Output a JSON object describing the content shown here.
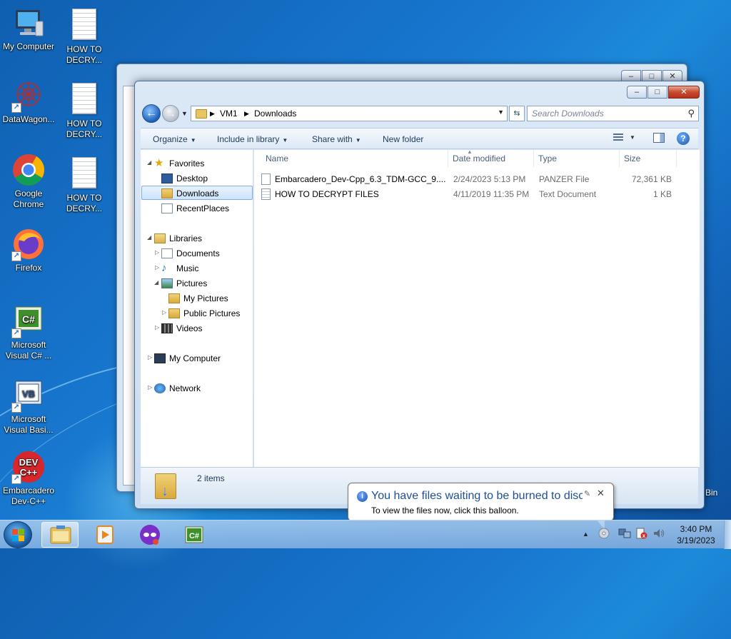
{
  "desktop": {
    "icons": [
      {
        "label": "My Computer"
      },
      {
        "label": "HOW TO DECRY..."
      },
      {
        "label": "DataWagon..."
      },
      {
        "label": "HOW TO DECRY..."
      },
      {
        "label": "Google Chrome"
      },
      {
        "label": "HOW TO DECRY..."
      },
      {
        "label": "Firefox"
      },
      {
        "label": "Microsoft Visual C# ..."
      },
      {
        "label": "Microsoft Visual Basi..."
      },
      {
        "label": "Embarcadero Dev-C++"
      }
    ],
    "bin_label": "Bin"
  },
  "explorer": {
    "caption": {
      "minimize": "–",
      "maximize": "□",
      "close": "✕"
    },
    "breadcrumb": [
      "VM1",
      "Downloads"
    ],
    "search_placeholder": "Search Downloads",
    "toolbar": {
      "organize": "Organize",
      "include": "Include in library",
      "share": "Share with",
      "new_folder": "New folder"
    },
    "nav": {
      "favorites": "Favorites",
      "desktop": "Desktop",
      "downloads": "Downloads",
      "recent": "RecentPlaces",
      "libraries": "Libraries",
      "documents": "Documents",
      "music": "Music",
      "pictures": "Pictures",
      "my_pictures": "My Pictures",
      "public_pictures": "Public Pictures",
      "videos": "Videos",
      "computer": "My Computer",
      "network": "Network"
    },
    "columns": {
      "name": "Name",
      "date": "Date modified",
      "type": "Type",
      "size": "Size"
    },
    "files": [
      {
        "name": "Embarcadero_Dev-Cpp_6.3_TDM-GCC_9....",
        "date": "2/24/2023 5:13 PM",
        "type": "PANZER File",
        "size": "72,361 KB"
      },
      {
        "name": "HOW TO DECRYPT FILES",
        "date": "4/11/2019 11:35 PM",
        "type": "Text Document",
        "size": "1 KB"
      }
    ],
    "status": {
      "count": "2 items"
    }
  },
  "balloon": {
    "title": "You have files waiting to be burned to disc",
    "body": "To view the files now, click this balloon."
  },
  "taskbar": {
    "time": "3:40 PM",
    "date": "3/19/2023"
  }
}
